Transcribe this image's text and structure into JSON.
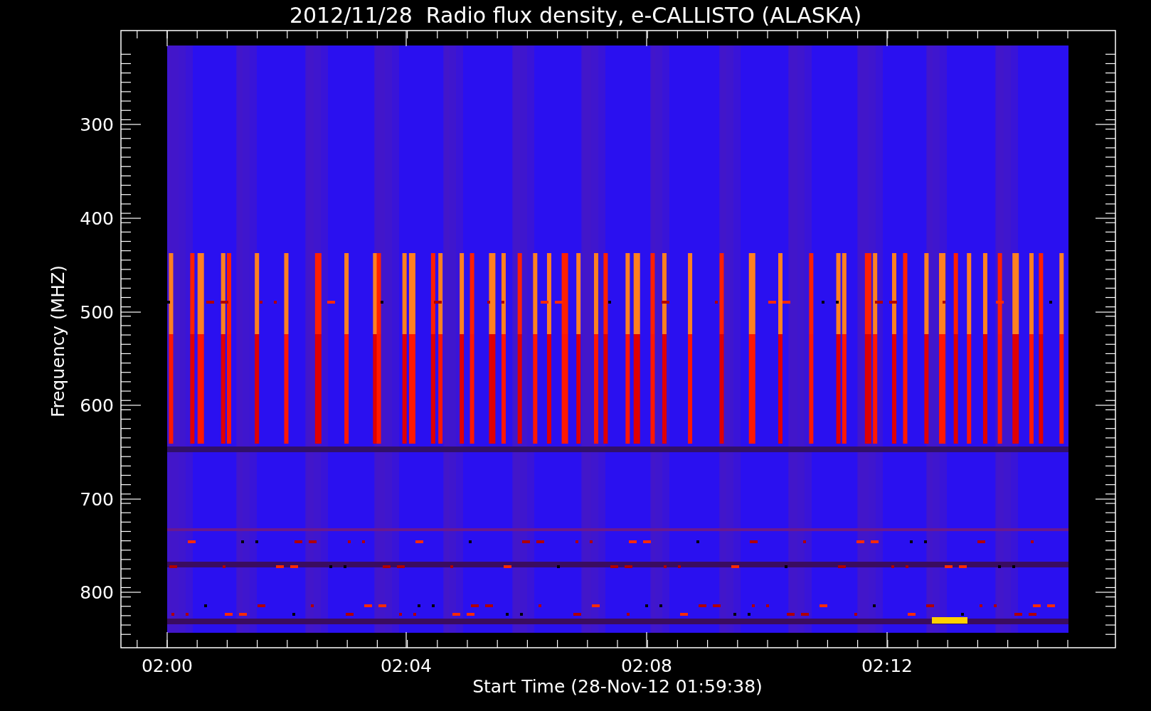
{
  "title": "2012/11/28  Radio flux density, e-CALLISTO (ALASKA)",
  "y_axis": {
    "label": "Frequency (MHZ)",
    "ticks": [
      "300",
      "400",
      "500",
      "600",
      "700",
      "800"
    ]
  },
  "x_axis": {
    "label": "Start Time (28-Nov-12 01:59:38)",
    "ticks": [
      "02:00",
      "02:04",
      "02:08",
      "02:12"
    ]
  }
}
